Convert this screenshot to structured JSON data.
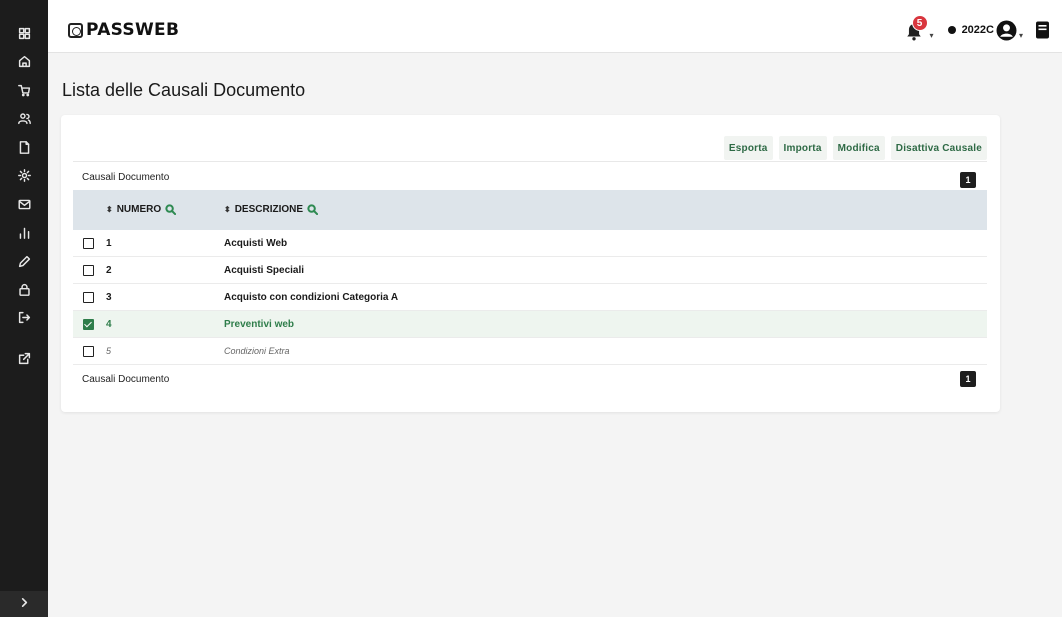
{
  "app": {
    "logo_text": "PASSWEB",
    "notification_count": "5",
    "year": "2022C"
  },
  "sidebar": {
    "items": [
      {
        "icon": "grid-icon"
      },
      {
        "icon": "home-icon"
      },
      {
        "icon": "cart-icon"
      },
      {
        "icon": "users-icon"
      },
      {
        "icon": "document-icon"
      },
      {
        "icon": "gear-icon"
      },
      {
        "icon": "mail-icon"
      },
      {
        "icon": "chart-icon"
      },
      {
        "icon": "pencil-icon"
      },
      {
        "icon": "lock-icon"
      },
      {
        "icon": "logout-icon"
      },
      {
        "icon": "external-link-icon"
      }
    ],
    "expand_icon": "chevron-right-icon"
  },
  "page": {
    "title": "Lista delle Causali Documento"
  },
  "toolbar": {
    "export_label": "Esporta",
    "import_label": "Importa",
    "edit_label": "Modifica",
    "deactivate_label": "Disattiva Causale"
  },
  "table": {
    "caption_top": "Causali Documento",
    "caption_bottom": "Causali Documento",
    "page_top": "1",
    "page_bottom": "1",
    "columns": {
      "number": "NUMERO",
      "description": "DESCRIZIONE"
    },
    "rows": [
      {
        "number": "1",
        "description": "Acquisti Web",
        "checked": false
      },
      {
        "number": "2",
        "description": "Acquisti Speciali",
        "checked": false
      },
      {
        "number": "3",
        "description": "Acquisto con condizioni Categoria A",
        "checked": false
      },
      {
        "number": "4",
        "description": "Preventivi web",
        "checked": true
      },
      {
        "number": "5",
        "description": "Condizioni Extra",
        "checked": false
      }
    ]
  },
  "colors": {
    "sidebar": "#1c1c1c",
    "accent_green": "#2e7d4a",
    "badge_red": "#d9363e",
    "table_header": "#dde4ea"
  }
}
